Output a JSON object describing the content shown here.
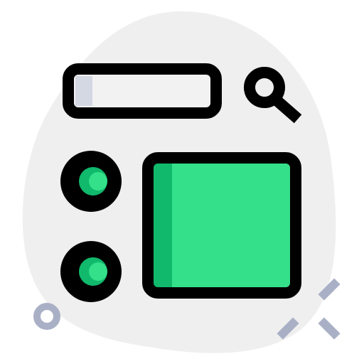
{
  "icon": {
    "semantic_name": "search-with-layout-icon",
    "parts": {
      "blob": "background-blob",
      "search_bar": "search-bar-icon",
      "magnifier": "magnifier-icon",
      "radio_1": "radio-button-icon",
      "radio_2": "radio-button-icon",
      "panel": "content-panel-icon",
      "ring": "decorative-ring-icon",
      "sparkles": "decorative-sparkle-icon"
    }
  },
  "colors": {
    "blob": "#efefef",
    "outline": "#000000",
    "search_bar_fill": "#f2f2f2",
    "search_bar_shade": "#d3d8e3",
    "accent_green": "#34e089",
    "accent_green_shade": "#10b96c",
    "decoration": "#a9b0c6"
  }
}
